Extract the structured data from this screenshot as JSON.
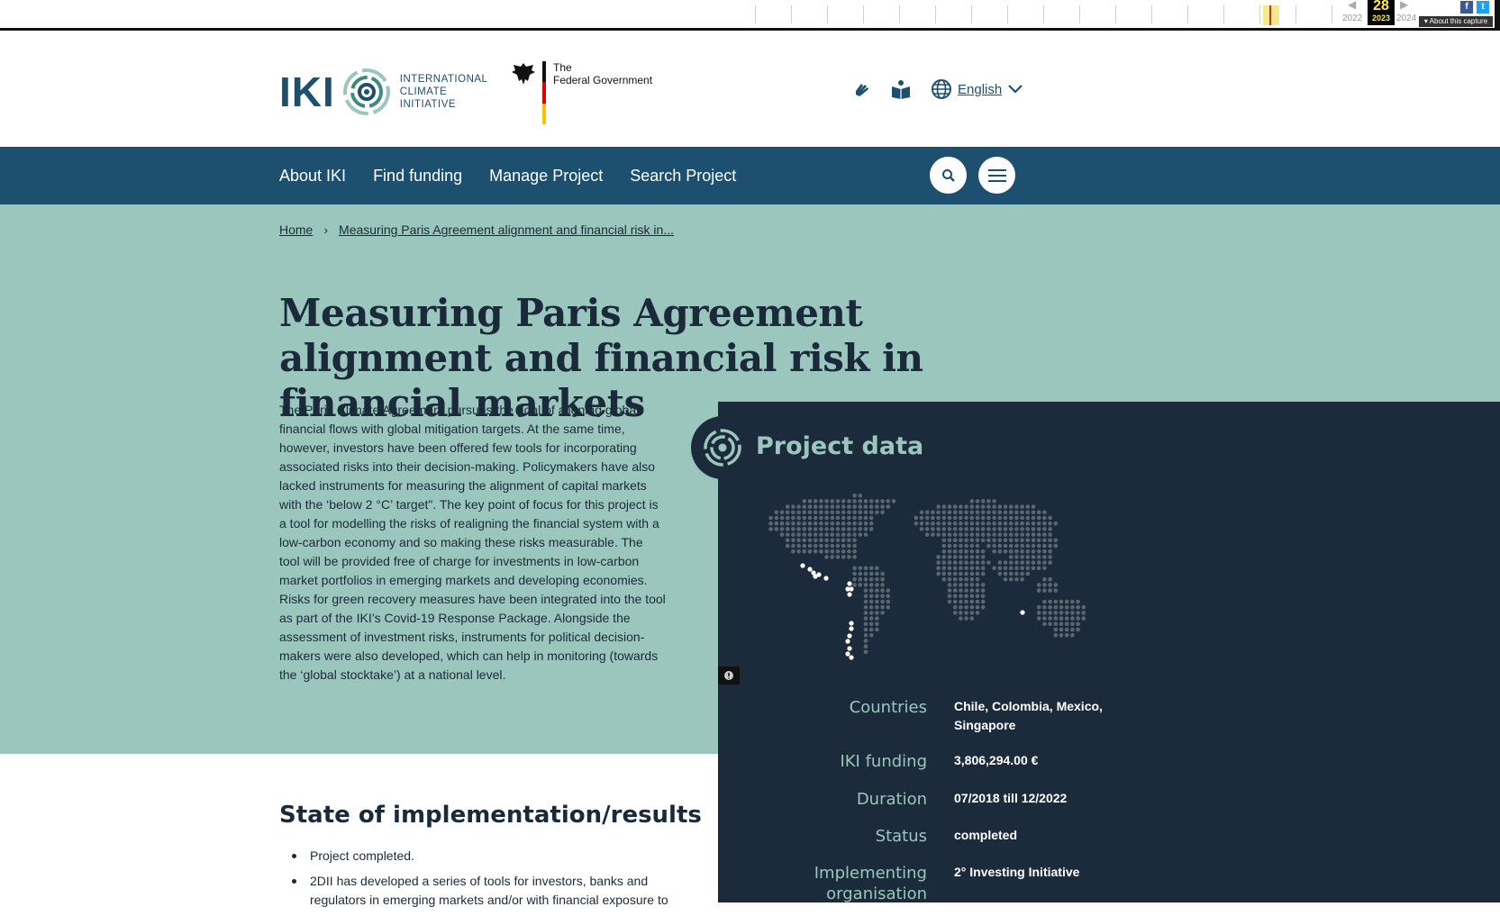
{
  "wayback": {
    "year_prev": "2022",
    "year_current": "2023",
    "year_next": "2024",
    "day": "28",
    "about_label": "▾ About this capture",
    "facebook_icon": "f",
    "twitter_icon": "t"
  },
  "header": {
    "logo_letters": "IKI",
    "logo_lines": [
      "INTERNATIONAL",
      "CLIMATE",
      "INITIATIVE"
    ],
    "gov_lines": [
      "The",
      "Federal Government"
    ],
    "language": "English",
    "icons": [
      "sign-language-icon",
      "easy-read-icon",
      "globe-icon",
      "chevron-down-icon"
    ]
  },
  "nav": {
    "items": [
      "About IKI",
      "Find funding",
      "Manage Project",
      "Search Project"
    ]
  },
  "breadcrumb": {
    "home": "Home",
    "separator": "›",
    "current": "Measuring Paris Agreement alignment and financial risk in..."
  },
  "page": {
    "title": "Measuring Paris Agreement alignment and financial risk in financial markets",
    "intro": "The Paris Climate Agreement pursues the goal of aligning global financial flows with global mitigation targets. At the same time, however, investors have been offered few tools for incorporating associated risks into their decision-making. Policymakers have also lacked instruments for measuring the alignment of capital markets with the ‘below 2 °C’ target\". The key point of focus for this project is a tool for modelling the risks of realigning the financial system with a low-carbon economy and so making these risks measurable. The tool will be provided free of charge for investments in low-carbon market portfolios in emerging markets and developing economies. Risks for green recovery measures have been integrated into the tool as part of the IKI’s Covid-19 Response Package. Alongside the assessment of investment risks, instruments for political decision-makers were also developed, which can help in monitoring (towards the ‘global stocktake’) at a national level."
  },
  "project_data": {
    "title": "Project data",
    "rows": [
      {
        "label": "Countries",
        "value": "Chile, Colombia, Mexico, Singapore"
      },
      {
        "label": "IKI funding",
        "value": "3,806,294.00 €"
      },
      {
        "label": "Duration",
        "value": "07/2018 till 12/2022"
      },
      {
        "label": "Status",
        "value": "completed"
      },
      {
        "label": "Implementing organisation",
        "value": "2° Investing Initiative"
      }
    ]
  },
  "results": {
    "title": "State of implementation/results",
    "items": [
      "Project completed.",
      "2DII has developed a series of tools for investors, banks and regulators in emerging markets and/or with financial exposure to"
    ]
  },
  "colors": {
    "navy": "#1d4f6e",
    "mint": "#9ac6bd",
    "panel": "#1c2b3b"
  }
}
